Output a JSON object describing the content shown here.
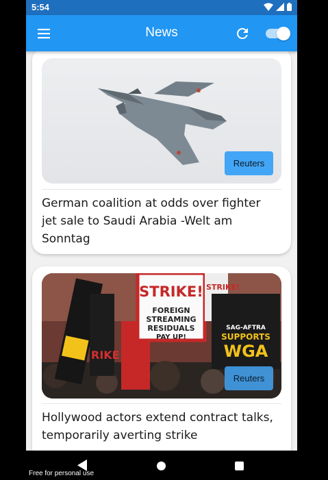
{
  "status_bar": {
    "time": "5:54"
  },
  "app_bar": {
    "title": "News"
  },
  "articles": [
    {
      "source": "Reuters",
      "headline": "German coalition at odds over fighter jet sale to Saudi Arabia -Welt am Sonntag"
    },
    {
      "source": "Reuters",
      "headline": "Hollywood actors extend contract talks, temporarily averting strike"
    }
  ],
  "photo_signs": [
    "STRIKE!",
    "FOREIGN",
    "STREAMING",
    "RESIDUALS",
    "PAY UP!",
    "SAG-AFTRA",
    "SUPPORTS",
    "WGA",
    "STRIKE!",
    "RIKE!"
  ],
  "watermark": "Free for personal use",
  "colors": {
    "app_bar": "#2196f3",
    "status_bar": "#1f6fbf",
    "badge": "#42a5f5"
  },
  "icons": [
    "wifi-icon",
    "signal-icon",
    "battery-icon",
    "menu-icon",
    "refresh-icon",
    "back-icon",
    "home-icon",
    "recents-icon"
  ]
}
